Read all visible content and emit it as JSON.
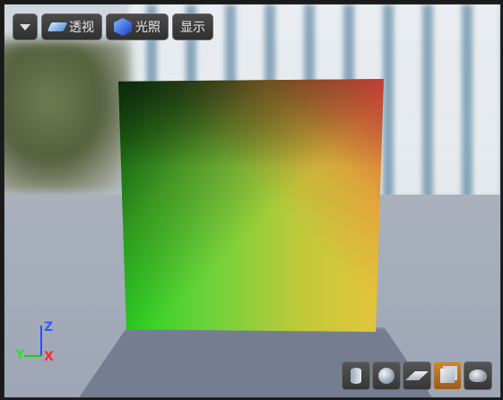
{
  "toolbar": {
    "perspective_label": "透视",
    "lighting_label": "光照",
    "show_label": "显示"
  },
  "axes": {
    "z": "Z",
    "y": "Y",
    "x": "X"
  },
  "colors": {
    "toolbar_bg": "#3a3a3a",
    "active_button": "#b87228",
    "axis_x": "#ff2a2a",
    "axis_y": "#18d018",
    "axis_z": "#2d4bff"
  },
  "bottom_tools": [
    {
      "name": "cylinder-icon",
      "active": false
    },
    {
      "name": "sphere-icon",
      "active": false
    },
    {
      "name": "plane-icon",
      "active": false
    },
    {
      "name": "cube-icon",
      "active": true
    },
    {
      "name": "teapot-icon",
      "active": false
    }
  ]
}
